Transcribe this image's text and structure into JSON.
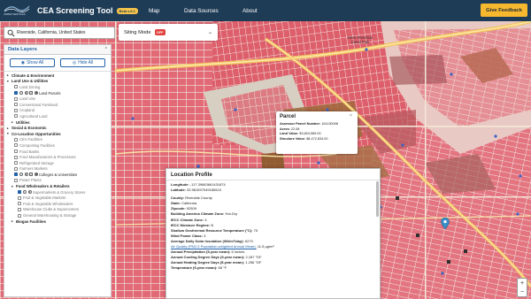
{
  "header": {
    "logo_text": "ARMED SERVICES",
    "title": "CEA Screening Tool",
    "beta": "Beta v.6.1",
    "nav": [
      "Map",
      "Data Sources",
      "About"
    ],
    "feedback": "Give Feedback"
  },
  "search": {
    "value": "Riverside, California, United States",
    "icon": "search-icon"
  },
  "siting": {
    "label": "Siting Mode",
    "status": "OFF",
    "chevron": "⌄"
  },
  "panel": {
    "title": "Data Layers",
    "collapse": "^",
    "show_all": "Show All",
    "hide_all": "Hide All",
    "rows": [
      {
        "type": "cat",
        "label": "Climate & Environment",
        "arrow": "▸"
      },
      {
        "type": "cat",
        "label": "Land Use & Utilities",
        "arrow": "▾"
      },
      {
        "type": "item",
        "label": "Land Zoning",
        "checked": false
      },
      {
        "type": "item",
        "label": "Land Parcels",
        "checked": true,
        "symbols": [
          "circle",
          "half",
          "square",
          "fill"
        ]
      },
      {
        "type": "item",
        "label": "Land Use",
        "checked": false
      },
      {
        "type": "item",
        "label": "Conventional Farmland",
        "checked": false
      },
      {
        "type": "item",
        "label": "Cropland",
        "checked": false
      },
      {
        "type": "item",
        "label": "Agricultural Land",
        "checked": false
      },
      {
        "type": "sub",
        "label": "Utilities",
        "arrow": "▸"
      },
      {
        "type": "cat",
        "label": "Social & Economic",
        "arrow": "▸"
      },
      {
        "type": "cat",
        "label": "Co-Location Opportunities",
        "arrow": "▾"
      },
      {
        "type": "item",
        "label": "CEA Facilities",
        "checked": false
      },
      {
        "type": "item",
        "label": "Composting Facilities",
        "checked": false
      },
      {
        "type": "item",
        "label": "Food Banks",
        "checked": false
      },
      {
        "type": "item",
        "label": "Food Manufacturers & Processors",
        "checked": false
      },
      {
        "type": "item",
        "label": "Refrigerated Storage",
        "checked": false
      },
      {
        "type": "item",
        "label": "Farmers Markets",
        "checked": false
      },
      {
        "type": "item",
        "label": "Colleges & Universities",
        "checked": true,
        "symbols": [
          "circle",
          "half",
          "square",
          "fill"
        ]
      },
      {
        "type": "item",
        "label": "Power Plants",
        "checked": false
      },
      {
        "type": "sub",
        "label": "Food Wholesalers & Retailers",
        "arrow": "▾"
      },
      {
        "type": "subitem",
        "label": "Supermarkets & Grocery Stores",
        "checked": true,
        "symbols": [
          "circle",
          "half"
        ]
      },
      {
        "type": "subitem",
        "label": "Fruit & Vegetable Markets",
        "checked": false
      },
      {
        "type": "subitem",
        "label": "Fruit & Vegetable Wholesalers",
        "checked": false
      },
      {
        "type": "subitem",
        "label": "Warehouse Clubs & Supercenters",
        "checked": false
      },
      {
        "type": "subitem",
        "label": "General Warehousing & Storage",
        "checked": false
      },
      {
        "type": "sub",
        "label": "Biogas Facilities",
        "arrow": "▸"
      }
    ]
  },
  "parcel_popup": {
    "title": "Parcel",
    "close": "×",
    "fields": [
      {
        "k": "Assessor Parcel Number:",
        "v": "161130008"
      },
      {
        "k": "Acres:",
        "v": "22.08"
      },
      {
        "k": "Land Value:",
        "v": "$3,804,589.00"
      },
      {
        "k": "Structure Value:",
        "v": "$8,472,834.00"
      }
    ]
  },
  "location_profile": {
    "title": "Location Profile",
    "coords": [
      {
        "k": "Longitude:",
        "v": "-117.39663661431874"
      },
      {
        "k": "Latitude:",
        "v": "33.981597049180624"
      }
    ],
    "fields": [
      {
        "k": "County:",
        "v": "Riverside County"
      },
      {
        "k": "State:",
        "v": "California"
      },
      {
        "k": "Zipcode:",
        "v": "92509"
      },
      {
        "k": "Building America Climate Zone:",
        "v": "Hot-Dry"
      },
      {
        "k": "IECC Climate Zone:",
        "v": "3"
      },
      {
        "k": "IECC Moisture Regime:",
        "v": "B"
      },
      {
        "k": "Shallow Geothermal Resource Temperature (°C):",
        "v": "75"
      },
      {
        "k": "Wind Power Class:",
        "v": "3"
      },
      {
        "k": "Average Daily Solar Insolation (Wh/m²/day):",
        "v": "6270"
      }
    ],
    "link": {
      "k": "Air Quality (PM2.5 Population-weighted Annual Mean):",
      "v": "11.5 µg/m³"
    },
    "fields2": [
      {
        "k": "Annual Precipitation (5-year mean):",
        "v": "6 inches"
      },
      {
        "k": "Annual Cooling Degree Days (5-year mean):",
        "v": "2,187 °DF"
      },
      {
        "k": "Annual Heating Degree Days (5-year mean):",
        "v": "1,256 °DF"
      },
      {
        "k": "Temperature (5-year mean):",
        "v": "68 °F"
      }
    ]
  },
  "map_labels": {
    "west_riverside": "West Riverside\nCanal Park",
    "zoom_in": "+",
    "zoom_out": "−"
  },
  "colors": {
    "header": "#1f3c56",
    "accent": "#f5b82e",
    "parcel": "#e05262",
    "road": "#f3d27a",
    "link": "#2262a8"
  }
}
